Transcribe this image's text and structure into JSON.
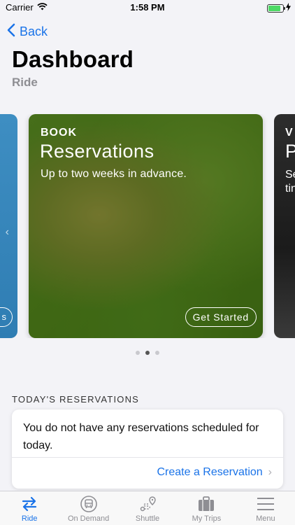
{
  "status_bar": {
    "carrier": "Carrier",
    "time": "1:58 PM",
    "battery_level": 0.85,
    "battery_color": "#4cd964"
  },
  "header": {
    "back_label": "Back",
    "title": "Dashboard",
    "subtitle": "Ride"
  },
  "carousel": {
    "prev_card": {
      "button_label": "s"
    },
    "main_card": {
      "kicker": "BOOK",
      "title": "Reservations",
      "description": "Up to two weeks in advance.",
      "button_label": "Get Started"
    },
    "next_card": {
      "kicker": "V",
      "title": "P",
      "description_line1": "Se",
      "description_line2": "tin"
    },
    "page_count": 3,
    "active_page": 2
  },
  "reservations": {
    "section_title": "TODAY'S RESERVATIONS",
    "empty_message": "You do not have any reservations scheduled for today.",
    "create_link": "Create a Reservation"
  },
  "tab_bar": {
    "accent_color": "#1a73e8",
    "items": [
      {
        "label": "Ride",
        "icon": "ride-arrows-icon",
        "active": true
      },
      {
        "label": "On Demand",
        "icon": "bus-icon",
        "active": false
      },
      {
        "label": "Shuttle",
        "icon": "route-icon",
        "active": false
      },
      {
        "label": "My Trips",
        "icon": "briefcase-icon",
        "active": false
      },
      {
        "label": "Menu",
        "icon": "menu-icon",
        "active": false
      }
    ]
  }
}
